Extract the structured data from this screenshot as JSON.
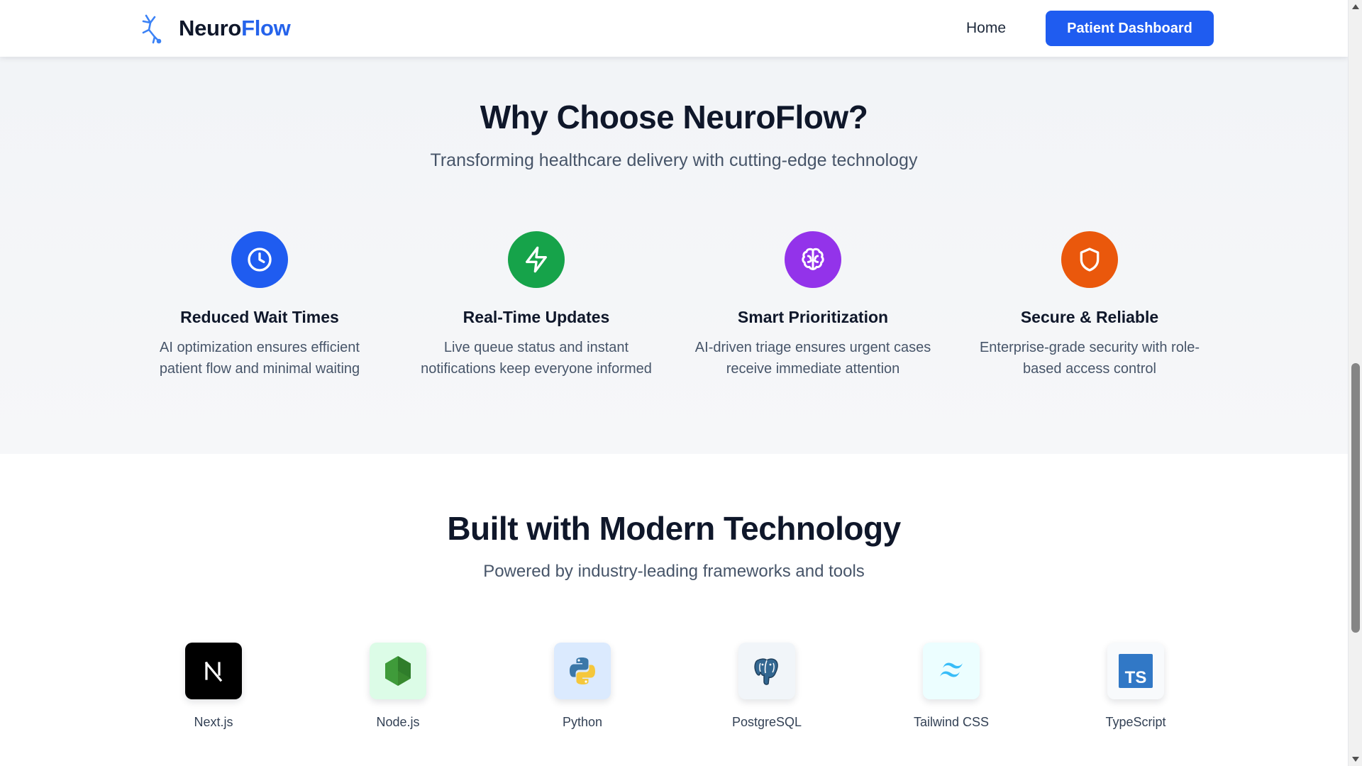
{
  "header": {
    "brand_part1": "Neuro",
    "brand_part2": "Flow",
    "nav_home": "Home",
    "nav_cta": "Patient Dashboard"
  },
  "why": {
    "title": "Why Choose NeuroFlow?",
    "subtitle": "Transforming healthcare delivery with cutting-edge technology",
    "features": [
      {
        "title": "Reduced Wait Times",
        "desc": "AI optimization ensures efficient patient flow and minimal waiting",
        "icon": "clock-icon",
        "color": "#1f5cf0"
      },
      {
        "title": "Real-Time Updates",
        "desc": "Live queue status and instant notifications keep everyone informed",
        "icon": "lightning-icon",
        "color": "#16a34a"
      },
      {
        "title": "Smart Prioritization",
        "desc": "AI-driven triage ensures urgent cases receive immediate attention",
        "icon": "brain-icon",
        "color": "#9333ea"
      },
      {
        "title": "Secure & Reliable",
        "desc": "Enterprise-grade security with role-based access control",
        "icon": "shield-icon",
        "color": "#ea580c"
      }
    ]
  },
  "tech": {
    "title": "Built with Modern Technology",
    "subtitle": "Powered by industry-leading frameworks and tools",
    "items": [
      {
        "name": "Next.js",
        "icon": "nextjs-icon"
      },
      {
        "name": "Node.js",
        "icon": "nodejs-icon"
      },
      {
        "name": "Python",
        "icon": "python-icon"
      },
      {
        "name": "PostgreSQL",
        "icon": "postgresql-icon"
      },
      {
        "name": "Tailwind CSS",
        "icon": "tailwind-icon"
      },
      {
        "name": "TypeScript",
        "icon": "typescript-icon"
      }
    ]
  },
  "colors": {
    "brand": "#1f5cf0",
    "text": "#0f172a",
    "muted": "#475569"
  }
}
